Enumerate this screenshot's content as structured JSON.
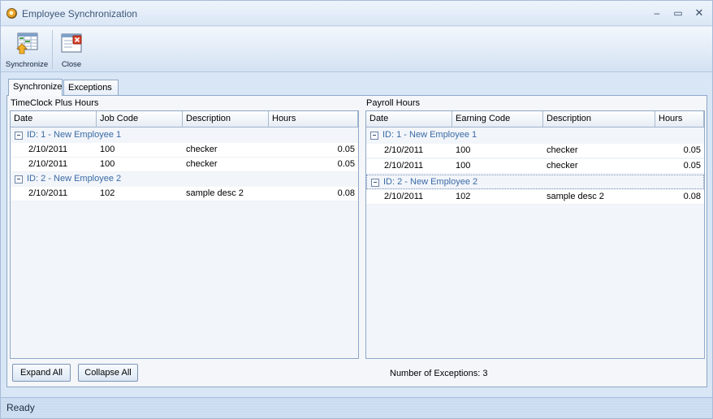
{
  "window": {
    "title": "Employee Synchronization"
  },
  "toolbar": {
    "synchronize_label": "Synchronize",
    "close_label": "Close"
  },
  "tabs": [
    {
      "label": "Synchronize",
      "active": true
    },
    {
      "label": "Exceptions",
      "active": false
    }
  ],
  "timeclock": {
    "title": "TimeClock Plus Hours",
    "columns": [
      "Date",
      "Job Code",
      "Description",
      "Hours"
    ],
    "groups": [
      {
        "label": "ID: 1 - New Employee 1",
        "rows": [
          {
            "date": "2/10/2011",
            "code": "100",
            "description": "checker",
            "hours": "0.05"
          },
          {
            "date": "2/10/2011",
            "code": "100",
            "description": "checker",
            "hours": "0.05"
          }
        ]
      },
      {
        "label": "ID: 2 - New Employee 2",
        "rows": [
          {
            "date": "2/10/2011",
            "code": "102",
            "description": "sample desc 2",
            "hours": "0.08"
          }
        ]
      }
    ]
  },
  "payroll": {
    "title": "Payroll Hours",
    "columns": [
      "Date",
      "Earning Code",
      "Description",
      "Hours"
    ],
    "groups": [
      {
        "label": "ID: 1 - New Employee 1",
        "rows": [
          {
            "date": "2/10/2011",
            "code": "100",
            "description": "checker",
            "hours": "0.05"
          },
          {
            "date": "2/10/2011",
            "code": "100",
            "description": "checker",
            "hours": "0.05"
          }
        ]
      },
      {
        "label": "ID: 2 - New Employee 2",
        "rows": [
          {
            "date": "2/10/2011",
            "code": "102",
            "description": "sample desc 2",
            "hours": "0.08"
          }
        ]
      }
    ]
  },
  "buttons": {
    "expand_all": "Expand All",
    "collapse_all": "Collapse All"
  },
  "exceptions": {
    "text": "Number of Exceptions: 3"
  },
  "status": {
    "text": "Ready"
  },
  "icons": {
    "app": "clock-icon",
    "synchronize": "synchronize-icon",
    "close": "close-window-icon",
    "minimize": "minimize-icon",
    "maximize": "maximize-icon",
    "window_close": "close-icon",
    "collapse": "collapse-minus-icon"
  }
}
